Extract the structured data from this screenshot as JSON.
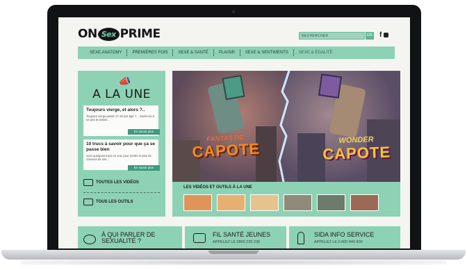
{
  "site": {
    "logo": {
      "left": "ON",
      "middle": "Sex",
      "right": "PRIME"
    },
    "search": {
      "placeholder": "RECHERCHER",
      "button": "OK"
    },
    "social": "f | ",
    "nav": [
      "SEXE ANATOMY",
      "PREMIÈRES FOIS",
      "SEXE & SANTÉ",
      "PLAISIR",
      "SEXE & SENTIMENTS",
      "SEXE & ÉGALITÉ"
    ]
  },
  "sidebar": {
    "title": "A LA UNE",
    "cards": [
      {
        "title": "Toujours vierge, et alors ?..",
        "text": "Toujours vierge passé 17-18 ans âge ?... Sache-toi à ne pas te laisser...",
        "button": "En savoir plus"
      },
      {
        "title": "10 trucs à savoir pour que ça se passe bien",
        "text": "Voici quelques trucs en vrac pour mettre le plus de chances de son...",
        "button": "En savoir plus"
      }
    ],
    "links": [
      "TOUTES LES VIDÉOS",
      "TOUS LES OUTILS"
    ]
  },
  "hero": {
    "left_small": "FANTASTIC",
    "left_big": "CAPOTE",
    "right_small": "WONDER",
    "right_big": "CAPOTE"
  },
  "videos": {
    "title": "LES VIDÉOS ET OUTILS À LA UNE",
    "thumb_colors": [
      "#e0945a",
      "#e8b070",
      "#e6c38c",
      "#8f8a7a",
      "#6d7b6d",
      "#9a6a55"
    ]
  },
  "bottom": [
    {
      "title": "À QUI PARLER DE SEXUALITÉ ?",
      "sub": ""
    },
    {
      "title": "FIL SANTÉ JEUNES",
      "sub": "APPELEZ LE 0800 235 236"
    },
    {
      "title": "SIDA INFO SERVICE",
      "sub": "APPELEZ LE 0 800 840 800"
    }
  ],
  "colors": {
    "mint": "#8ed2b5",
    "accent": "#3f9a7c",
    "bezel": "#111214"
  }
}
